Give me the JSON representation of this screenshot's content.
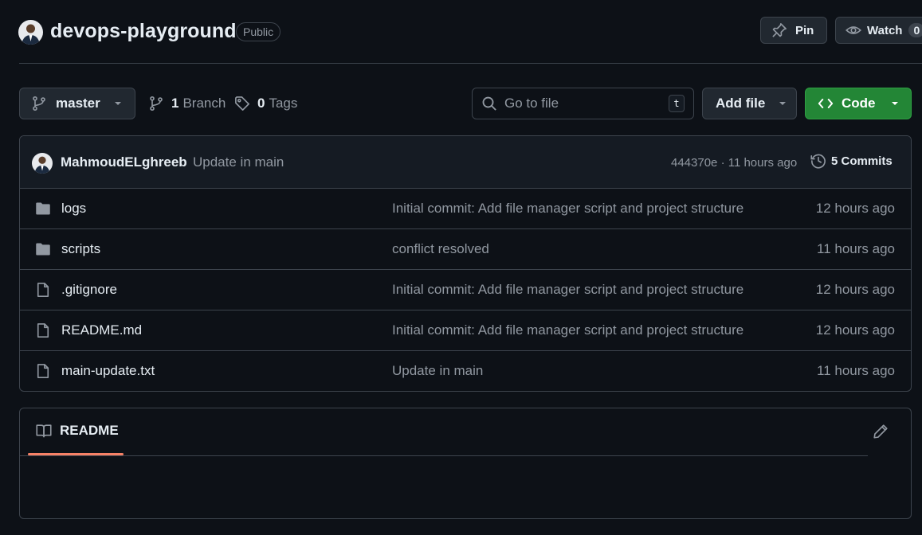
{
  "header": {
    "repo_name": "devops-playground",
    "visibility": "Public",
    "pin_label": "Pin",
    "watch_label": "Watch",
    "watch_count": "0"
  },
  "toolbar": {
    "branch_name": "master",
    "branch_count": "1",
    "branch_label": "Branch",
    "tag_count": "0",
    "tag_label": "Tags",
    "search_placeholder": "Go to file",
    "search_shortcut": "t",
    "add_file_label": "Add file",
    "code_label": "Code"
  },
  "latest_commit": {
    "author": "MahmoudELghreeb",
    "message": "Update in main",
    "hash_time": "444370e · 11 hours ago",
    "commits_label": "5 Commits"
  },
  "files": [
    {
      "type": "folder",
      "name": "logs",
      "commit": "Initial commit: Add file manager script and project structure",
      "time": "12 hours ago"
    },
    {
      "type": "folder",
      "name": "scripts",
      "commit": "conflict resolved",
      "time": "11 hours ago"
    },
    {
      "type": "file",
      "name": ".gitignore",
      "commit": "Initial commit: Add file manager script and project structure",
      "time": "12 hours ago"
    },
    {
      "type": "file",
      "name": "README.md",
      "commit": "Initial commit: Add file manager script and project structure",
      "time": "12 hours ago"
    },
    {
      "type": "file",
      "name": "main-update.txt",
      "commit": "Update in main",
      "time": "11 hours ago"
    }
  ],
  "readme": {
    "tab_label": "README"
  },
  "colors": {
    "background": "#0d1117",
    "border": "#3d444d",
    "code_button": "#238636",
    "active_tab_underline": "#f78166"
  }
}
